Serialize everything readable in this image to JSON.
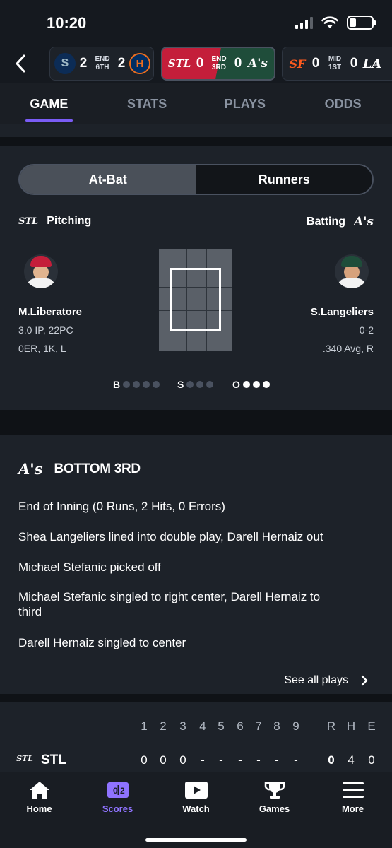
{
  "status_bar": {
    "time": "10:20"
  },
  "ribbon": {
    "games": [
      {
        "away_logo": "S",
        "away_score": "2",
        "state_line1": "END",
        "state_line2": "6TH",
        "home_score": "2",
        "home_logo": "H"
      },
      {
        "away_logo": "STL",
        "away_score": "0",
        "state_line1": "END",
        "state_line2": "3RD",
        "home_score": "0",
        "home_logo": "A's"
      },
      {
        "away_logo": "SF",
        "away_score": "0",
        "state_line1": "MID",
        "state_line2": "1ST",
        "home_score": "0",
        "home_logo": "LA"
      }
    ]
  },
  "tabs": [
    "GAME",
    "STATS",
    "PLAYS",
    "ODDS"
  ],
  "at_bat": {
    "toggle": {
      "left": "At-Bat",
      "right": "Runners"
    },
    "pitching_label": "Pitching",
    "batting_label": "Batting",
    "pitching_team_glyph": "STL",
    "batting_team_glyph": "A's",
    "pitcher": {
      "name": "M.Liberatore",
      "line1": "3.0 IP, 22PC",
      "line2": "0ER, 1K, L"
    },
    "batter": {
      "name": "S.Langeliers",
      "line1": "0-2",
      "line2": ".340 Avg, R"
    },
    "count": {
      "balls_label": "B",
      "strikes_label": "S",
      "outs_label": "O",
      "balls": 0,
      "strikes": 0,
      "outs": 3
    }
  },
  "plays": {
    "team_glyph": "A's",
    "title": "BOTTOM 3RD",
    "items": [
      "End of Inning (0 Runs, 2 Hits, 0 Errors)",
      "Shea Langeliers lined into double play, Darell Hernaiz out",
      "Michael Stefanic picked off",
      "Michael Stefanic singled to right center, Darell Hernaiz to third",
      "Darell Hernaiz singled to center"
    ],
    "see_all": "See all plays"
  },
  "linescore": {
    "innings": [
      "1",
      "2",
      "3",
      "4",
      "5",
      "6",
      "7",
      "8",
      "9"
    ],
    "totals_headers": [
      "R",
      "H",
      "E"
    ],
    "rows": [
      {
        "team": "STL",
        "innings": [
          "0",
          "0",
          "0",
          "-",
          "-",
          "-",
          "-",
          "-",
          "-"
        ],
        "totals": [
          "0",
          "4",
          "0"
        ]
      }
    ]
  },
  "bottom_nav": {
    "items": [
      {
        "label": "Home",
        "icon": "home-icon"
      },
      {
        "label": "Scores",
        "icon": "scores-icon"
      },
      {
        "label": "Watch",
        "icon": "play-icon"
      },
      {
        "label": "Games",
        "icon": "trophy-icon"
      },
      {
        "label": "More",
        "icon": "menu-icon"
      }
    ],
    "active": "Scores"
  },
  "colors": {
    "accent": "#7a5cf5",
    "cardinals_red": "#c41e3a",
    "athletics_green": "#1f4d3a",
    "giants_orange": "#fd5a1e"
  }
}
